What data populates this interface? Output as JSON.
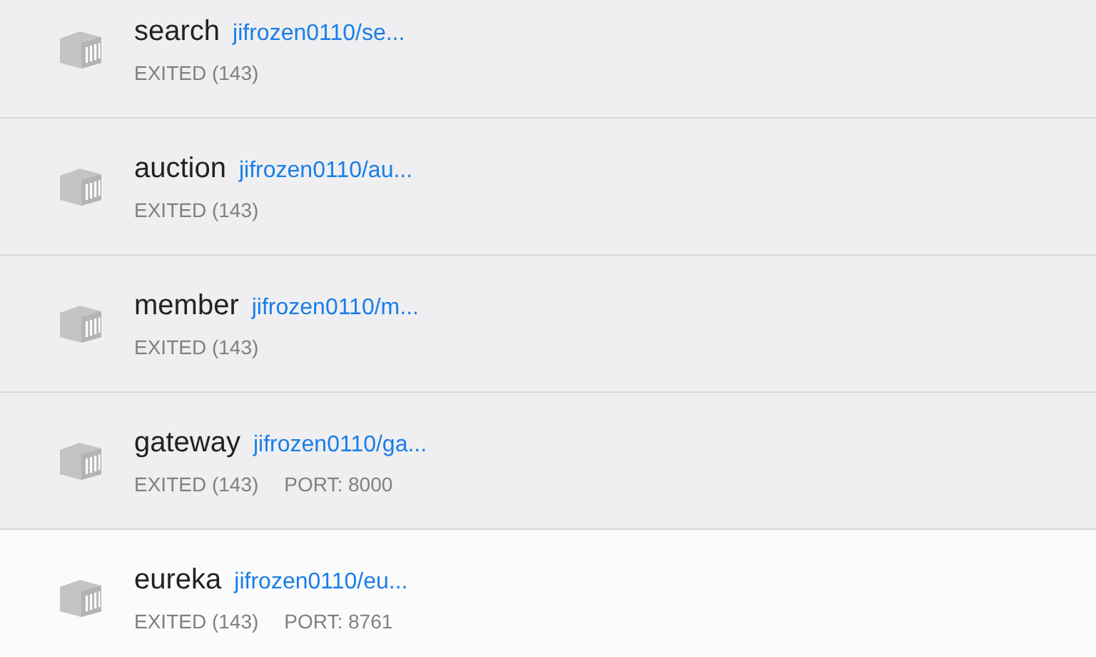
{
  "containers": [
    {
      "name": "search",
      "image": "jifrozen0110/se...",
      "status": "EXITED (143)",
      "selected": false
    },
    {
      "name": "auction",
      "image": "jifrozen0110/au...",
      "status": "EXITED (143)",
      "selected": false
    },
    {
      "name": "member",
      "image": "jifrozen0110/m...",
      "status": "EXITED (143)",
      "selected": false
    },
    {
      "name": "gateway",
      "image": "jifrozen0110/ga...",
      "status": "EXITED (143)",
      "port": "PORT: 8000",
      "selected": false
    },
    {
      "name": "eureka",
      "image": "jifrozen0110/eu...",
      "status": "EXITED (143)",
      "port": "PORT: 8761",
      "selected": true
    }
  ]
}
